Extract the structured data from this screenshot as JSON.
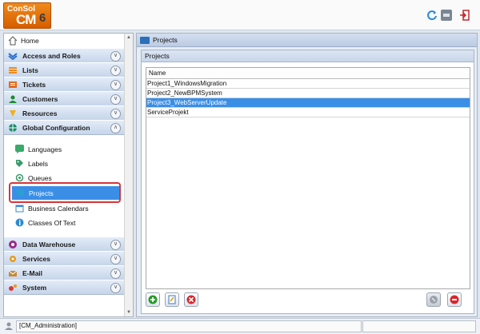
{
  "header": {
    "logo_line1": "ConSol",
    "logo_line2": "CM",
    "logo_line3": "6"
  },
  "nav": {
    "home": "Home",
    "sections_top": [
      {
        "label": "Access and Roles",
        "icon": "access-roles-icon",
        "color": "#2a6fd0"
      },
      {
        "label": "Lists",
        "icon": "lists-icon",
        "color": "#f08a1a"
      },
      {
        "label": "Tickets",
        "icon": "tickets-icon",
        "color": "#e46a1a"
      },
      {
        "label": "Customers",
        "icon": "customers-icon",
        "color": "#1a8a2a"
      },
      {
        "label": "Resources",
        "icon": "resources-icon",
        "color": "#f0b01a"
      },
      {
        "label": "Global Configuration",
        "icon": "globe-icon",
        "color": "#1a8a6a"
      }
    ],
    "sub_items": [
      {
        "label": "Languages",
        "icon": "languages-icon"
      },
      {
        "label": "Labels",
        "icon": "labels-icon"
      },
      {
        "label": "Queues",
        "icon": "queues-icon"
      },
      {
        "label": "Projects",
        "icon": "projects-icon"
      },
      {
        "label": "Business Calendars",
        "icon": "business-calendars-icon"
      },
      {
        "label": "Classes Of Text",
        "icon": "classes-of-text-icon"
      }
    ],
    "sections_bottom": [
      {
        "label": "Data Warehouse",
        "icon": "data-warehouse-icon",
        "color": "#9a2a8a"
      },
      {
        "label": "Services",
        "icon": "services-icon",
        "color": "#e69a1a"
      },
      {
        "label": "E-Mail",
        "icon": "email-icon",
        "color": "#c68a3a"
      },
      {
        "label": "System",
        "icon": "system-icon",
        "color": "#d63a3a"
      }
    ]
  },
  "main": {
    "panel_title": "Projects",
    "inner_title": "Projects",
    "table": {
      "column_header": "Name",
      "rows": [
        "Project1_WindowsMigration",
        "Project2_NewBPMSystem",
        "Project3_WebServerUpdate",
        "ServiceProjekt"
      ],
      "selected_index": 2
    },
    "actions": [
      "add-icon",
      "edit-icon",
      "delete-icon",
      "lock-icon",
      "remove-icon"
    ]
  },
  "status": {
    "user": "[CM_Administration]"
  },
  "colors": {
    "accent": "#3a8ee6",
    "highlight_border": "#d9343a"
  }
}
